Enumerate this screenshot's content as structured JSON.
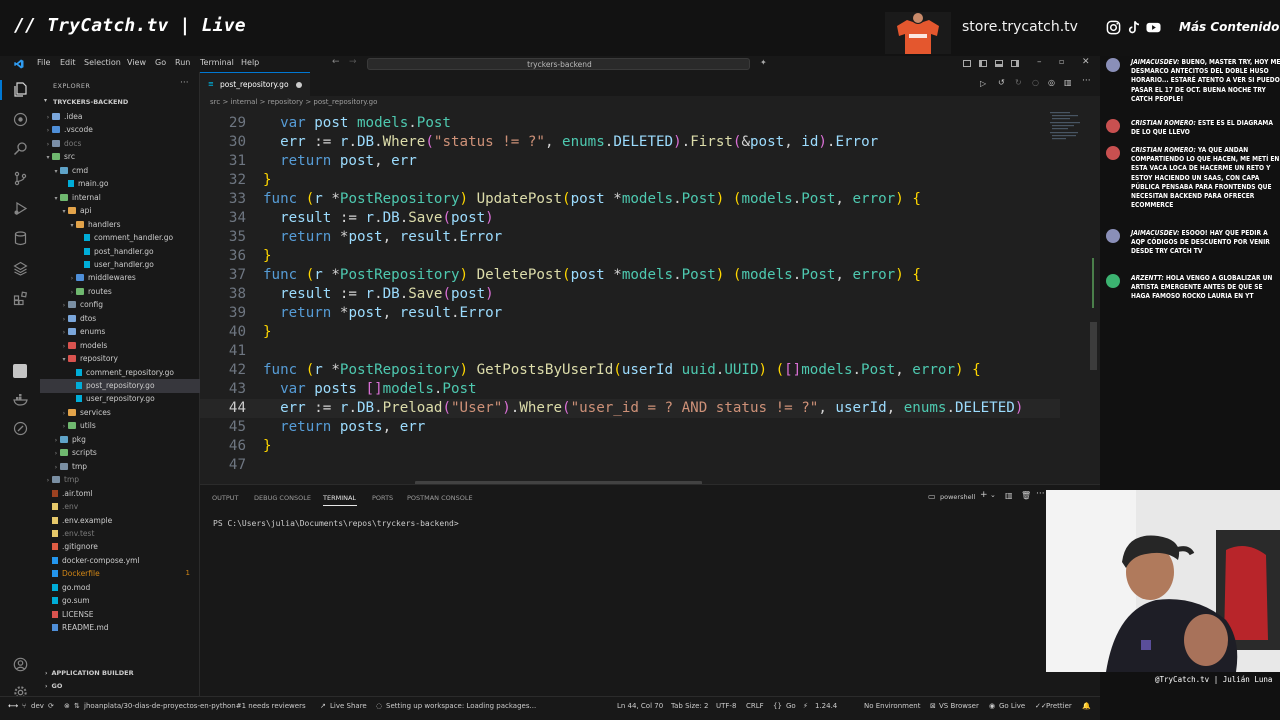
{
  "stream": {
    "title": "// TryCatch.tv | Live",
    "store_url": "store.trycatch.tv",
    "more_content": "Más Contenido",
    "webcam_caption": "@TryCatch.tv | Julián Luna",
    "social_icons": [
      "instagram-icon",
      "tiktok-icon",
      "youtube-icon"
    ]
  },
  "chat": {
    "messages": [
      {
        "author": "JAIMACUSDEV:",
        "text": "BUENO, MASTER TRY, HOY ME DESMARCO ANTECITOS DEL DOBLE HUSO HORARIO... ESTARÉ ATENTO A VER SI PUEDO PASAR EL 17 DE OCT. BUENA NOCHE TRY CATCH PEOPLE!",
        "avatar_color": "#8a8fb8"
      },
      {
        "author": "CRISTIAN ROMERO:",
        "text": "ESTE ES EL DIAGRAMA DE LO QUE LLEVO",
        "avatar_color": "#c85050"
      },
      {
        "author": "CRISTIAN ROMERO:",
        "text": "YA QUE ANDAN COMPARTIENDO LO QUE HACEN, ME METÍ EN ESTA VACA LOCA DE HACERME UN RETO Y ESTOY HACIENDO UN SAAS, CON CAPA PÚBLICA PENSABA PARA FRONTENDS QUE NECESITAN BACKEND PARA OFRECER ECOMMERCE",
        "avatar_color": "#c85050"
      },
      {
        "author": "JAIMACUSDEV:",
        "text": "ESOOO! HAY QUE PEDIR A AQP CÓDIGOS DE DESCUENTO POR VENIR DESDE TRY CATCH TV",
        "avatar_color": "#8a8fb8"
      },
      {
        "author": "ARZENTT:",
        "text": "HOLA VENGO A GLOBALIZAR UN ARTISTA EMERGENTE ANTES DE QUE SE HAGA FAMOSO ROCKO LAURIA EN YT",
        "avatar_color": "#3cb371"
      }
    ]
  },
  "menu": [
    "File",
    "Edit",
    "Selection",
    "View",
    "Go",
    "Run",
    "Terminal",
    "Help"
  ],
  "command_center": "tryckers-backend",
  "explorer": {
    "label": "EXPLORER",
    "project": "TRYCKERS-BACKEND",
    "tree": [
      {
        "label": ".idea",
        "depth": 1,
        "type": "folder",
        "open": false,
        "color": "#7aa6da"
      },
      {
        "label": ".vscode",
        "depth": 1,
        "type": "folder",
        "open": false,
        "color": "#4f8fd8"
      },
      {
        "label": "docs",
        "depth": 1,
        "type": "folder",
        "open": false,
        "color": "#7b8fa8",
        "dim": true
      },
      {
        "label": "src",
        "depth": 1,
        "type": "folder",
        "open": true,
        "color": "#6fb86f"
      },
      {
        "label": "cmd",
        "depth": 2,
        "type": "folder",
        "open": true,
        "color": "#5fa3c8"
      },
      {
        "label": "main.go",
        "depth": 3,
        "type": "file",
        "color": "#00add8"
      },
      {
        "label": "internal",
        "depth": 2,
        "type": "folder",
        "open": true,
        "color": "#6fb86f"
      },
      {
        "label": "api",
        "depth": 3,
        "type": "folder",
        "open": true,
        "color": "#e2a34a"
      },
      {
        "label": "handlers",
        "depth": 4,
        "type": "folder",
        "open": true,
        "color": "#e2a34a"
      },
      {
        "label": "comment_handler.go",
        "depth": 5,
        "type": "file",
        "color": "#00add8"
      },
      {
        "label": "post_handler.go",
        "depth": 5,
        "type": "file",
        "color": "#00add8"
      },
      {
        "label": "user_handler.go",
        "depth": 5,
        "type": "file",
        "color": "#00add8"
      },
      {
        "label": "middlewares",
        "depth": 4,
        "type": "folder",
        "open": false,
        "color": "#4f8fd8"
      },
      {
        "label": "routes",
        "depth": 4,
        "type": "folder",
        "open": false,
        "color": "#6fb86f"
      },
      {
        "label": "config",
        "depth": 3,
        "type": "folder",
        "open": false,
        "color": "#7a8fa3"
      },
      {
        "label": "dtos",
        "depth": 3,
        "type": "folder",
        "open": false,
        "color": "#7aa6da"
      },
      {
        "label": "enums",
        "depth": 3,
        "type": "folder",
        "open": false,
        "color": "#7aa6da"
      },
      {
        "label": "models",
        "depth": 3,
        "type": "folder",
        "open": false,
        "color": "#d9534f"
      },
      {
        "label": "repository",
        "depth": 3,
        "type": "folder",
        "open": true,
        "color": "#d9534f"
      },
      {
        "label": "comment_repository.go",
        "depth": 4,
        "type": "file",
        "color": "#00add8"
      },
      {
        "label": "post_repository.go",
        "depth": 4,
        "type": "file",
        "color": "#00add8",
        "selected": true
      },
      {
        "label": "user_repository.go",
        "depth": 4,
        "type": "file",
        "color": "#00add8"
      },
      {
        "label": "services",
        "depth": 3,
        "type": "folder",
        "open": false,
        "color": "#e2a34a"
      },
      {
        "label": "utils",
        "depth": 3,
        "type": "folder",
        "open": false,
        "color": "#6fb86f"
      },
      {
        "label": "pkg",
        "depth": 2,
        "type": "folder",
        "open": false,
        "color": "#5fa3c8"
      },
      {
        "label": "scripts",
        "depth": 2,
        "type": "folder",
        "open": false,
        "color": "#6fb86f"
      },
      {
        "label": "tmp",
        "depth": 2,
        "type": "folder",
        "open": false,
        "color": "#7a8fa3"
      },
      {
        "label": "tmp",
        "depth": 1,
        "type": "folder",
        "open": false,
        "color": "#7a8fa3",
        "dim": true
      },
      {
        "label": ".air.toml",
        "depth": 1,
        "type": "file",
        "color": "#9c4221"
      },
      {
        "label": ".env",
        "depth": 1,
        "type": "file",
        "color": "#e6c86a",
        "dim": true
      },
      {
        "label": ".env.example",
        "depth": 1,
        "type": "file",
        "color": "#e6c86a"
      },
      {
        "label": ".env.test",
        "depth": 1,
        "type": "file",
        "color": "#e6c86a",
        "dim": true
      },
      {
        "label": ".gitignore",
        "depth": 1,
        "type": "file",
        "color": "#e05d44"
      },
      {
        "label": "docker-compose.yml",
        "depth": 1,
        "type": "file",
        "color": "#2496ed"
      },
      {
        "label": "Dockerfile",
        "depth": 1,
        "type": "file",
        "color": "#2496ed",
        "badge": "1",
        "warn": true
      },
      {
        "label": "go.mod",
        "depth": 1,
        "type": "file",
        "color": "#00add8"
      },
      {
        "label": "go.sum",
        "depth": 1,
        "type": "file",
        "color": "#00add8"
      },
      {
        "label": "LICENSE",
        "depth": 1,
        "type": "file",
        "color": "#d9534f"
      },
      {
        "label": "README.md",
        "depth": 1,
        "type": "file",
        "color": "#4f8fd8"
      }
    ],
    "app_builder": "APPLICATION BUILDER",
    "go_section": "GO"
  },
  "tab": {
    "label": "post_repository.go"
  },
  "breadcrumb": "src > internal > repository > post_repository.go",
  "code_lines": [
    {
      "n": "29",
      "html": "  <span class='k'>var</span> <span class='v'>post</span> <span class='t'>models</span><span class='p'>.</span><span class='t'>Post</span>"
    },
    {
      "n": "30",
      "html": "  <span class='v'>err</span> <span class='p'>:=</span> <span class='v'>r</span><span class='p'>.</span><span class='v'>DB</span><span class='p'>.</span><span class='f'>Where</span><span class='br2'>(</span><span class='s'>\"status != ?\"</span><span class='p'>,</span> <span class='t'>enums</span><span class='p'>.</span><span class='v'>DELETED</span><span class='br2'>)</span><span class='p'>.</span><span class='f'>First</span><span class='br2'>(</span><span class='p'>&amp;</span><span class='v'>post</span><span class='p'>,</span> <span class='v'>id</span><span class='br2'>)</span><span class='p'>.</span><span class='v'>Error</span>"
    },
    {
      "n": "31",
      "html": "  <span class='k'>return</span> <span class='v'>post</span><span class='p'>,</span> <span class='v'>err</span>"
    },
    {
      "n": "32",
      "html": "<span class='br'>}</span>"
    },
    {
      "n": "33",
      "html": "<span class='k'>func</span> <span class='br'>(</span><span class='v'>r</span> <span class='p'>*</span><span class='t'>PostRepository</span><span class='br'>)</span> <span class='f'>UpdatePost</span><span class='br'>(</span><span class='v'>post</span> <span class='p'>*</span><span class='t'>models</span><span class='p'>.</span><span class='t'>Post</span><span class='br'>)</span> <span class='br'>(</span><span class='t'>models</span><span class='p'>.</span><span class='t'>Post</span><span class='p'>,</span> <span class='t'>error</span><span class='br'>)</span> <span class='br'>{</span>"
    },
    {
      "n": "34",
      "html": "  <span class='v'>result</span> <span class='p'>:=</span> <span class='v'>r</span><span class='p'>.</span><span class='v'>DB</span><span class='p'>.</span><span class='f'>Save</span><span class='br2'>(</span><span class='v'>post</span><span class='br2'>)</span>"
    },
    {
      "n": "35",
      "html": "  <span class='k'>return</span> <span class='p'>*</span><span class='v'>post</span><span class='p'>,</span> <span class='v'>result</span><span class='p'>.</span><span class='v'>Error</span>"
    },
    {
      "n": "36",
      "html": "<span class='br'>}</span>"
    },
    {
      "n": "37",
      "html": "<span class='k'>func</span> <span class='br'>(</span><span class='v'>r</span> <span class='p'>*</span><span class='t'>PostRepository</span><span class='br'>)</span> <span class='f'>DeletePost</span><span class='br'>(</span><span class='v'>post</span> <span class='p'>*</span><span class='t'>models</span><span class='p'>.</span><span class='t'>Post</span><span class='br'>)</span> <span class='br'>(</span><span class='t'>models</span><span class='p'>.</span><span class='t'>Post</span><span class='p'>,</span> <span class='t'>error</span><span class='br'>)</span> <span class='br'>{</span>"
    },
    {
      "n": "38",
      "html": "  <span class='v'>result</span> <span class='p'>:=</span> <span class='v'>r</span><span class='p'>.</span><span class='v'>DB</span><span class='p'>.</span><span class='f'>Save</span><span class='br2'>(</span><span class='v'>post</span><span class='br2'>)</span>"
    },
    {
      "n": "39",
      "html": "  <span class='k'>return</span> <span class='p'>*</span><span class='v'>post</span><span class='p'>,</span> <span class='v'>result</span><span class='p'>.</span><span class='v'>Error</span>"
    },
    {
      "n": "40",
      "html": "<span class='br'>}</span>"
    },
    {
      "n": "41",
      "html": ""
    },
    {
      "n": "42",
      "html": "<span class='k'>func</span> <span class='br'>(</span><span class='v'>r</span> <span class='p'>*</span><span class='t'>PostRepository</span><span class='br'>)</span> <span class='f'>GetPostsByUserId</span><span class='br'>(</span><span class='v'>userId</span> <span class='t'>uuid</span><span class='p'>.</span><span class='t'>UUID</span><span class='br'>)</span> <span class='br'>(</span><span class='br2'>[]</span><span class='t'>models</span><span class='p'>.</span><span class='t'>Post</span><span class='p'>,</span> <span class='t'>error</span><span class='br'>)</span> <span class='br'>{</span>"
    },
    {
      "n": "43",
      "html": "  <span class='k'>var</span> <span class='v'>posts</span> <span class='br2'>[]</span><span class='t'>models</span><span class='p'>.</span><span class='t'>Post</span>"
    },
    {
      "n": "44",
      "html": "  <span class='v'>err</span> <span class='p'>:=</span> <span class='v'>r</span><span class='p'>.</span><span class='v'>DB</span><span class='p'>.</span><span class='f'>Preload</span><span class='br2'>(</span><span class='s'>\"User\"</span><span class='br2'>)</span><span class='p'>.</span><span class='f'>Where</span><span class='br2'>(</span><span class='s'>\"user_id = ? AND status != ?\"</span><span class='p'>,</span> <span class='v'>userId</span><span class='p'>,</span> <span class='t'>enums</span><span class='p'>.</span><span class='v'>DELETED</span><span class='br2'>)</span>",
      "current": true
    },
    {
      "n": "45",
      "html": "  <span class='k'>return</span> <span class='v'>posts</span><span class='p'>,</span> <span class='v'>err</span>"
    },
    {
      "n": "46",
      "html": "<span class='br'>}</span>"
    },
    {
      "n": "47",
      "html": ""
    }
  ],
  "panel": {
    "tabs": [
      "OUTPUT",
      "DEBUG CONSOLE",
      "TERMINAL",
      "PORTS",
      "POSTMAN CONSOLE"
    ],
    "active_tab": "TERMINAL",
    "shell": "powershell",
    "prompt": "PS C:\\Users\\julia\\Documents\\repos\\tryckers-backend>"
  },
  "status": {
    "branch": "dev",
    "pr": "jhoanplata/30-dias-de-proyectos-en-python#1 needs reviewers",
    "live_share": "Live Share",
    "workspace": "Setting up workspace: Loading packages...",
    "position": "Ln 44, Col 70",
    "tab_size": "Tab Size: 2",
    "encoding": "UTF-8",
    "eol": "CRLF",
    "language": "Go",
    "go_version": "1.24.4",
    "environment": "No Environment",
    "browser": "VS Browser",
    "go_live": "Go Live",
    "prettier": "Prettier"
  }
}
